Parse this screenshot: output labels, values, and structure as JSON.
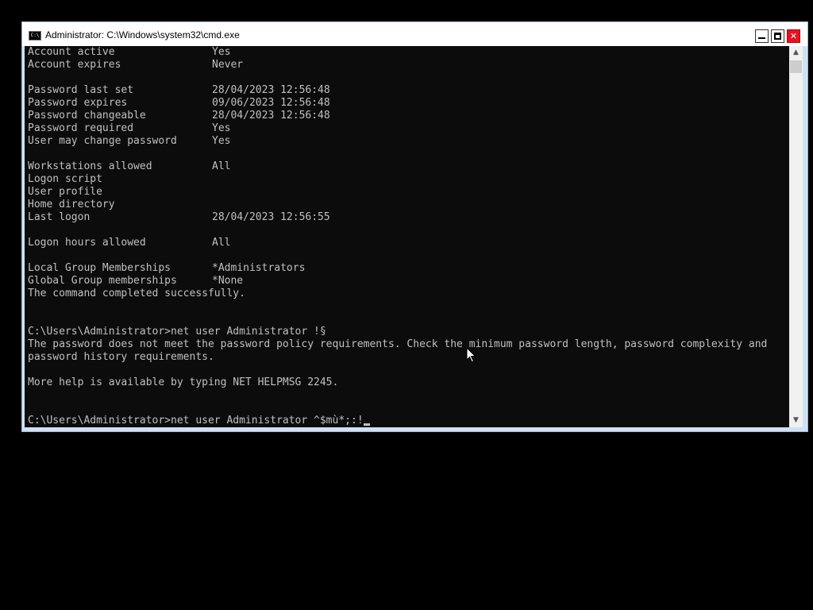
{
  "window": {
    "title": "Administrator: C:\\Windows\\system32\\cmd.exe",
    "icon": "cmd-icon",
    "icon_text": "C:\\",
    "controls": {
      "minimize": "minimize-icon",
      "maximize": "maximize-icon",
      "close": "close-icon",
      "close_glyph": "✕"
    }
  },
  "console": {
    "lines": [
      {
        "label": "Account active",
        "value": "Yes"
      },
      {
        "label": "Account expires",
        "value": "Never"
      },
      {
        "label": "",
        "value": ""
      },
      {
        "label": "Password last set",
        "value": "28/04/2023 12:56:48"
      },
      {
        "label": "Password expires",
        "value": "09/06/2023 12:56:48"
      },
      {
        "label": "Password changeable",
        "value": "28/04/2023 12:56:48"
      },
      {
        "label": "Password required",
        "value": "Yes"
      },
      {
        "label": "User may change password",
        "value": "Yes"
      },
      {
        "label": "",
        "value": ""
      },
      {
        "label": "Workstations allowed",
        "value": "All"
      },
      {
        "label": "Logon script",
        "value": ""
      },
      {
        "label": "User profile",
        "value": ""
      },
      {
        "label": "Home directory",
        "value": ""
      },
      {
        "label": "Last logon",
        "value": "28/04/2023 12:56:55"
      },
      {
        "label": "",
        "value": ""
      },
      {
        "label": "Logon hours allowed",
        "value": "All"
      },
      {
        "label": "",
        "value": ""
      },
      {
        "label": "Local Group Memberships",
        "value": "*Administrators"
      },
      {
        "label": "Global Group memberships",
        "value": "*None"
      },
      {
        "label": "The command completed successfully.",
        "value": ""
      },
      {
        "label": "",
        "value": ""
      },
      {
        "label": "",
        "value": ""
      },
      {
        "label": "C:\\Users\\Administrator>net user Administrator !§",
        "value": ""
      },
      {
        "label": "The password does not meet the password policy requirements. Check the minimum password length, password complexity and",
        "value": ""
      },
      {
        "label": "password history requirements.",
        "value": ""
      },
      {
        "label": "",
        "value": ""
      },
      {
        "label": "More help is available by typing NET HELPMSG 2245.",
        "value": ""
      },
      {
        "label": "",
        "value": ""
      },
      {
        "label": "",
        "value": ""
      }
    ],
    "prompt": "C:\\Users\\Administrator>",
    "current_input": "net user Administrator ^$mù*;:!",
    "text_color": "#c0c0c0",
    "background_color": "#0c0c0c"
  },
  "scrollbar": {
    "up_icon": "scroll-up-arrow-icon",
    "down_icon": "scroll-down-arrow-icon",
    "up_glyph": "▲",
    "down_glyph": "▼"
  },
  "pointer": {
    "icon": "mouse-pointer-icon"
  }
}
